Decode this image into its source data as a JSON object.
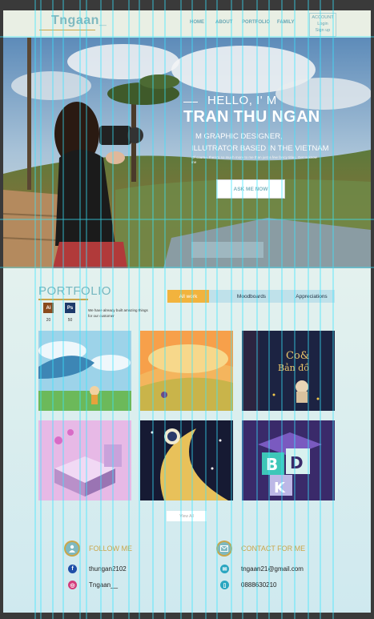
{
  "header": {
    "logo": "Tngaan_",
    "nav": [
      "HOME",
      "ABOUT",
      "PORTFOLIO",
      "FAMILY"
    ],
    "account": {
      "title": "ACCOUNT",
      "login": "Login",
      "signup": "Sign up"
    }
  },
  "hero": {
    "hello": "HELLO, I' M",
    "name": "TRAN THU NGAN",
    "role_line1": "M GRAPHIC DESIGNER,",
    "role_line2": "ILLUTRATOR BASED IN THE VIETNAM",
    "blurb": "Of course, there's so much more to me than just a few fancy titles. Get to know me",
    "cta": "ASK ME NOW"
  },
  "portfolio": {
    "title": "PORTFOLIO",
    "badges": [
      {
        "label": "Ai",
        "count": "20",
        "color": "#8a4b1d"
      },
      {
        "label": "Ps",
        "count": "50",
        "color": "#1d3a6a"
      }
    ],
    "description": "We have already built amazing things for our customer",
    "tabs": [
      "All work",
      "Moodboards",
      "Appreciations"
    ],
    "active_tab": "All work",
    "view_all": "View All"
  },
  "footer": {
    "follow_title": "FOLLOW ME",
    "facebook": "thungan2102",
    "instagram": "Tngaan__",
    "contact_title": "CONTACT FOR ME",
    "email": "tngaan21@gmail.com",
    "phone": "0888630210"
  },
  "colors": {
    "accent": "#7fb9c0",
    "gold": "#c9a64a",
    "tab_active": "#f2b33d",
    "guide": "#38e6ff"
  }
}
